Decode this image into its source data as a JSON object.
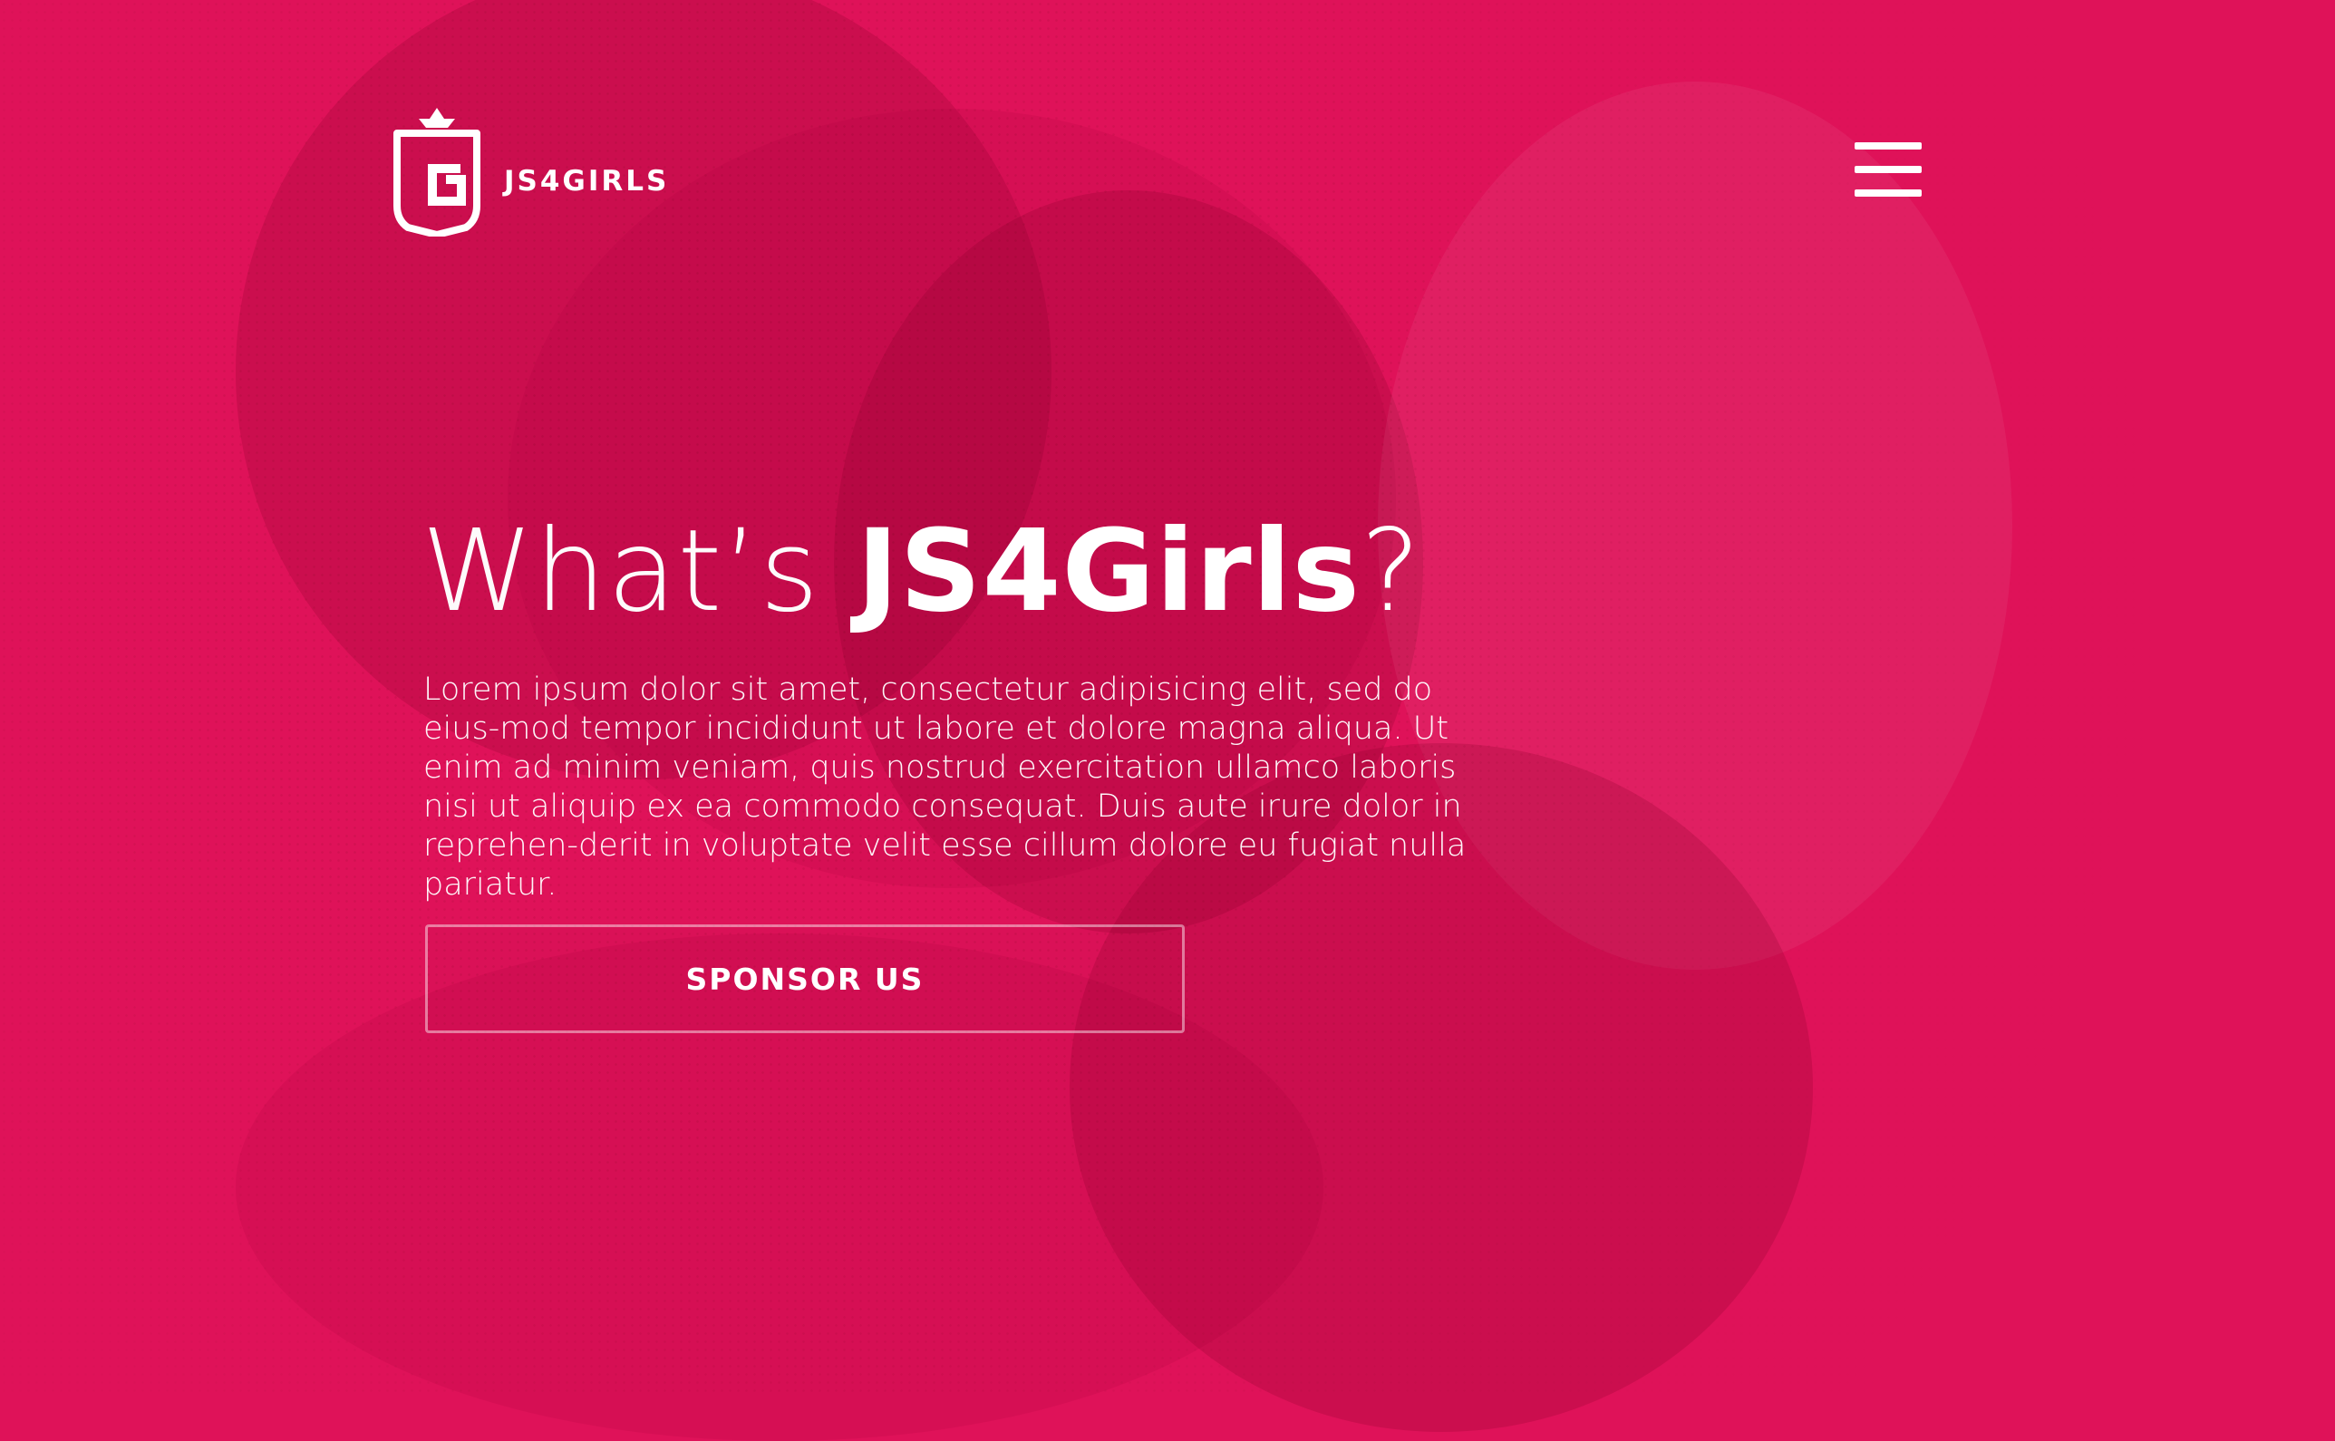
{
  "brand": {
    "name": "JS4GIRLS",
    "primary_color": "#df1259",
    "text_color": "#ffffff",
    "logo_icon": "shield-crown-logo-icon"
  },
  "header": {
    "menu_icon": "hamburger-menu-icon"
  },
  "hero": {
    "title_prefix": "What’s ",
    "title_highlight": "JS4Girls",
    "title_suffix": "?",
    "body": "Lorem ipsum dolor sit amet, consectetur adipisicing elit, sed do eius-mod tempor incididunt ut labore et dolore magna aliqua. Ut enim ad minim veniam, quis nostrud exercitation ullamco laboris nisi ut aliquip ex ea commodo consequat. Duis aute irure dolor in reprehen-derit in voluptate velit esse cillum dolore eu fugiat nulla pariatur.",
    "cta_label": "SPONSOR US"
  }
}
